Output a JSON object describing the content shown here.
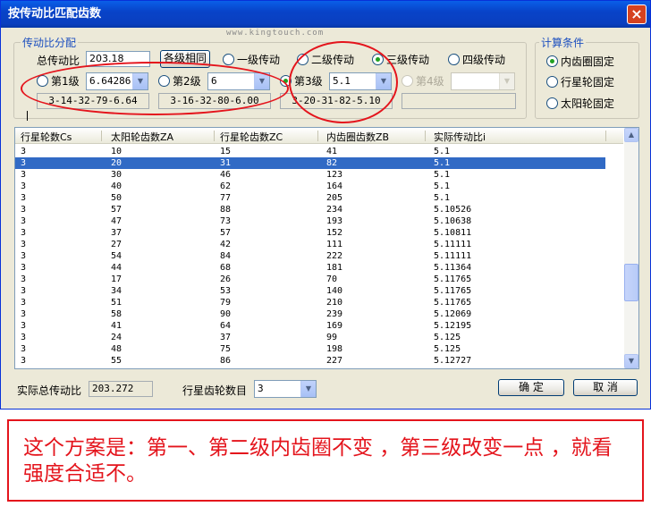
{
  "window": {
    "title": "按传动比匹配齿数",
    "close_label": "×",
    "watermark": "www.kingtouch.com"
  },
  "ratio_group": {
    "title": "传动比分配",
    "total_label": "总传动比",
    "total_value": "203.18",
    "same_button": "各级相同",
    "stage_types": [
      "一级传动",
      "二级传动",
      "三级传动",
      "四级传动"
    ],
    "selected_stage_type": "三级传动",
    "stages": [
      {
        "label": "第1级",
        "value": "6.64286",
        "result": "3-14-32-79-6.64"
      },
      {
        "label": "第2级",
        "value": "6",
        "result": "3-16-32-80-6.00"
      },
      {
        "label": "第3级",
        "value": "5.1",
        "result": "3-20-31-82-5.10"
      },
      {
        "label": "第4级",
        "value": "",
        "result": ""
      }
    ],
    "selected_stage": "第3级"
  },
  "calc_group": {
    "title": "计算条件",
    "options": [
      "内齿圈固定",
      "行星轮固定",
      "太阳轮固定"
    ],
    "selected": "内齿圈固定"
  },
  "table": {
    "columns": [
      "行星轮数Cs",
      "太阳轮齿数ZA",
      "行星轮齿数ZC",
      "内齿圈齿数ZB",
      "实际传动比i"
    ],
    "rows": [
      [
        "3",
        "10",
        "15",
        "41",
        "5.1"
      ],
      [
        "3",
        "20",
        "31",
        "82",
        "5.1"
      ],
      [
        "3",
        "30",
        "46",
        "123",
        "5.1"
      ],
      [
        "3",
        "40",
        "62",
        "164",
        "5.1"
      ],
      [
        "3",
        "50",
        "77",
        "205",
        "5.1"
      ],
      [
        "3",
        "57",
        "88",
        "234",
        "5.10526"
      ],
      [
        "3",
        "47",
        "73",
        "193",
        "5.10638"
      ],
      [
        "3",
        "37",
        "57",
        "152",
        "5.10811"
      ],
      [
        "3",
        "27",
        "42",
        "111",
        "5.11111"
      ],
      [
        "3",
        "54",
        "84",
        "222",
        "5.11111"
      ],
      [
        "3",
        "44",
        "68",
        "181",
        "5.11364"
      ],
      [
        "3",
        "17",
        "26",
        "70",
        "5.11765"
      ],
      [
        "3",
        "34",
        "53",
        "140",
        "5.11765"
      ],
      [
        "3",
        "51",
        "79",
        "210",
        "5.11765"
      ],
      [
        "3",
        "58",
        "90",
        "239",
        "5.12069"
      ],
      [
        "3",
        "41",
        "64",
        "169",
        "5.12195"
      ],
      [
        "3",
        "24",
        "37",
        "99",
        "5.125"
      ],
      [
        "3",
        "48",
        "75",
        "198",
        "5.125"
      ],
      [
        "3",
        "55",
        "86",
        "227",
        "5.12727"
      ]
    ],
    "selected_row": 1
  },
  "footer": {
    "actual_total_label": "实际总传动比",
    "actual_total_value": "203.272",
    "planet_count_label": "行星齿轮数目",
    "planet_count_value": "3",
    "ok_label": "确  定",
    "cancel_label": "取  消"
  },
  "annotation": {
    "text": "这个方案是：第一、第二级内齿圈不变 ，第三级改变一点 ，就看强度合适不。",
    "color": "#e4141c"
  }
}
